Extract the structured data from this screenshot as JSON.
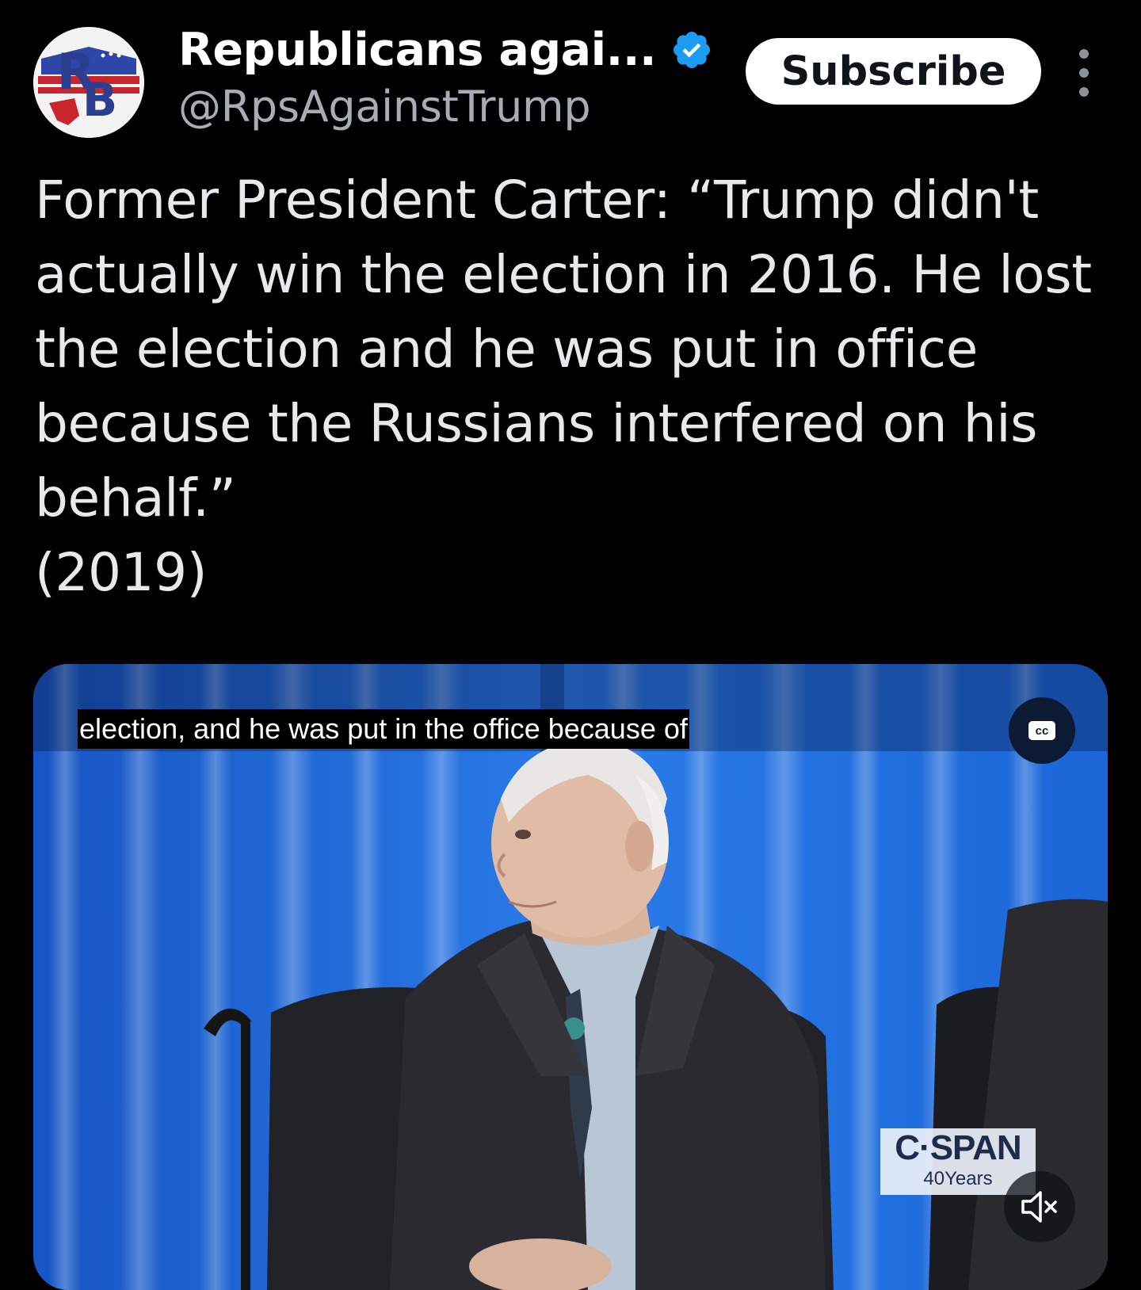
{
  "header": {
    "avatar_initials": "RB",
    "display_name": "Republicans agai...",
    "handle": "@RpsAgainstTrump",
    "verified_icon": "verified-badge-icon",
    "subscribe_label": "Subscribe",
    "more_icon": "more-vertical-icon"
  },
  "tweet": {
    "lines": [
      "Former President Carter: “Trump didn't",
      "actually win the election in 2016. He lost",
      "the election and he was put in office",
      "because the Russians interfered on his",
      "behalf.”",
      "(2019)"
    ]
  },
  "video": {
    "caption": "election, and he was put in the office because of",
    "cc_label": "cc",
    "watermark_main": "C·SPAN",
    "watermark_sub": "40Years",
    "mute_icon": "speaker-muted-icon"
  },
  "colors": {
    "background": "#000000",
    "text": "#e7e9ea",
    "handle": "#a7adb3",
    "verified": "#1d9bf0",
    "curtain": "#1a64d6"
  }
}
